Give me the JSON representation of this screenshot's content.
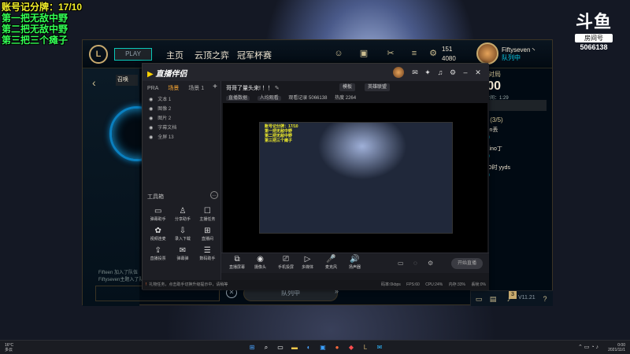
{
  "overlay": {
    "line1": "账号记分牌：17/10",
    "line2": "第一把无敌中野",
    "line3": "第二把无敌中野",
    "line4": "第三把三个瘫子"
  },
  "douyu": {
    "logo": "斗鱼",
    "sub": "房间号",
    "room": "5066138"
  },
  "lol": {
    "logo": "L",
    "play_button": "PLAY",
    "nav": [
      "主页",
      "云顶之弈",
      "冠军杯赛"
    ],
    "currency_rp": "151",
    "currency_be": "4080",
    "summoner_name": "Fiftyseven丶",
    "summoner_status": "队列中",
    "summon_label": "召唤",
    "side_text": [
      "Fifteen 加入了队伍",
      "Fiftyseven主题入了队伍"
    ],
    "find_match": "队列中",
    "social": {
      "header": "组队对局",
      "timer": "1:00",
      "sub": "估计时间：1:29",
      "rows": [
        {
          "name": "Fifteen丢",
          "status": "队列中"
        },
        {
          "name": "丢 ZZino丁",
          "status": "游戏中"
        },
        {
          "name": "NOBO时 yyds",
          "status": "队列中"
        }
      ],
      "count": "(3/5)",
      "friends": "好友",
      "badge": "3",
      "version": "V11.21"
    }
  },
  "tool": {
    "title": "直播伴侣",
    "left_tabs": [
      "PRA",
      "场景",
      "场景 1"
    ],
    "scenes": [
      {
        "label": "文本 1"
      },
      {
        "label": "图像 2"
      },
      {
        "label": "图片 2"
      },
      {
        "label": "字幕文档"
      },
      {
        "label": "全屏 13"
      }
    ],
    "tools_title": "工具箱",
    "tools": [
      {
        "icon": "▭",
        "label": "弹幕助手"
      },
      {
        "icon": "♙",
        "label": "分享助手"
      },
      {
        "icon": "☐",
        "label": "主播任务"
      },
      {
        "icon": "✿",
        "label": "视频连麦"
      },
      {
        "icon": "⇩",
        "label": "录入下载"
      },
      {
        "icon": "⊞",
        "label": "直播间"
      },
      {
        "icon": "⇪",
        "label": "直播投票"
      },
      {
        "icon": "✉",
        "label": "弹幕弹"
      },
      {
        "icon": "☰",
        "label": "数码助手"
      }
    ],
    "footer_note": "礼物任务  点击查看系统信息提示，请稍等",
    "room_title": "哥哥了量头来! ！！",
    "category": "模板",
    "partition": "英雄联盟",
    "room_meta": [
      "直播数据",
      "人均观看",
      "观看记录 5066138",
      "热度 2264"
    ],
    "bottom_buttons": [
      {
        "icon": "⧉",
        "label": "直播屏幕"
      },
      {
        "icon": "◉",
        "label": "摄像头"
      },
      {
        "icon": "⎚",
        "label": "手机投屏"
      },
      {
        "icon": "▷",
        "label": "多媒体"
      },
      {
        "icon": "🎤",
        "label": "麦克风"
      },
      {
        "icon": "🔊",
        "label": "扬声器"
      }
    ],
    "start_button": "开始直播",
    "status_warn": "!",
    "status_text": "礼物任务，点击助手切换升级提示中，请稍等",
    "stats": [
      "码率:0kbps",
      "FPS:60",
      "CPU:24%",
      "内存:33%",
      "丢帧:0%"
    ]
  },
  "taskbar": {
    "weather_temp": "16°C",
    "weather_desc": "多云",
    "time": "0:00",
    "date": "2021/11/1"
  }
}
